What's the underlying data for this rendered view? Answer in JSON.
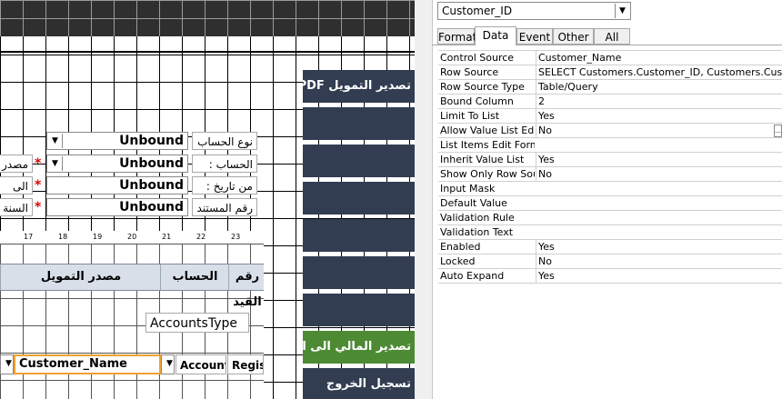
{
  "designer": {
    "labels": {
      "account_type": "نوع الحساب :",
      "account": "الحساب :",
      "from_date": "من تاريخ :",
      "doc_number": "رقم المستند :",
      "funding_source_cut": "مصدر",
      "to_cut": "الى",
      "year_cut": "السنة ا"
    },
    "unbound": [
      "Unbound",
      "Unbound",
      "Unbound",
      "Unbound"
    ],
    "buttons": [
      "تصدير التمويل PDF",
      "",
      "",
      "",
      "",
      "",
      "",
      "تصدير المالي الى Excel",
      "تسجيل الخروج"
    ],
    "ruler_ticks": [
      "17",
      "18",
      "19",
      "20",
      "21",
      "22",
      "23"
    ],
    "subform": {
      "headers": [
        "رقم القيد",
        "الحساب",
        "مصدر التمويل"
      ],
      "accounts_type": "AccountsType",
      "customer_name": "Customer_Name",
      "account": "Account",
      "regist": "Regist"
    }
  },
  "properties": {
    "selector_value": "Customer_ID",
    "tabs": [
      "Format",
      "Data",
      "Event",
      "Other",
      "All"
    ],
    "active_tab": "Data",
    "rows": [
      {
        "name": "Control Source",
        "value": "Customer_Name"
      },
      {
        "name": "Row Source",
        "value": "SELECT Customers.Customer_ID, Customers.Custome"
      },
      {
        "name": "Row Source Type",
        "value": "Table/Query"
      },
      {
        "name": "Bound Column",
        "value": "2"
      },
      {
        "name": "Limit To List",
        "value": "Yes"
      },
      {
        "name": "Allow Value List Edits",
        "value": "No"
      },
      {
        "name": "List Items Edit Form",
        "value": ""
      },
      {
        "name": "Inherit Value List",
        "value": "Yes"
      },
      {
        "name": "Show Only Row Source Values",
        "value": "No"
      },
      {
        "name": "Input Mask",
        "value": ""
      },
      {
        "name": "Default Value",
        "value": ""
      },
      {
        "name": "Validation Rule",
        "value": ""
      },
      {
        "name": "Validation Text",
        "value": ""
      },
      {
        "name": "Enabled",
        "value": "Yes"
      },
      {
        "name": "Locked",
        "value": "No"
      },
      {
        "name": "Auto Expand",
        "value": "Yes"
      }
    ]
  }
}
